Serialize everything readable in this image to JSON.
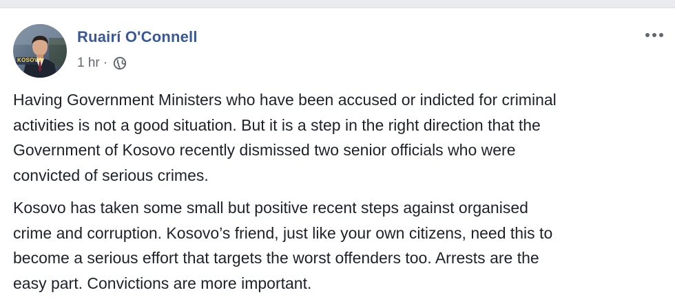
{
  "post": {
    "author": "Ruairí O'Connell",
    "timestamp": "1 hr",
    "separator": "·",
    "privacy_icon": "globe-icon",
    "more_icon": "ellipsis-icon",
    "avatar_caption": "KOSOVO",
    "paragraphs": [
      {
        "lines": [
          "Having Government Ministers who have been accused or indicted for criminal",
          "activities is not a good situation. But it is a step in the right direction that the",
          "Government of Kosovo recently dismissed two senior officials who were",
          "convicted of serious crimes."
        ]
      },
      {
        "lines": [
          "Kosovo has taken some small but positive recent steps against organised",
          "crime and corruption. Kosovo’s friend, just like your own citizens, need this to",
          "become a serious effort that targets the worst offenders too. Arrests are the",
          "easy part. Convictions are more important."
        ]
      }
    ]
  },
  "colors": {
    "author_link": "#385898",
    "meta_text": "#616770",
    "body_text": "#1d2129",
    "page_strip": "#e9ebee"
  }
}
